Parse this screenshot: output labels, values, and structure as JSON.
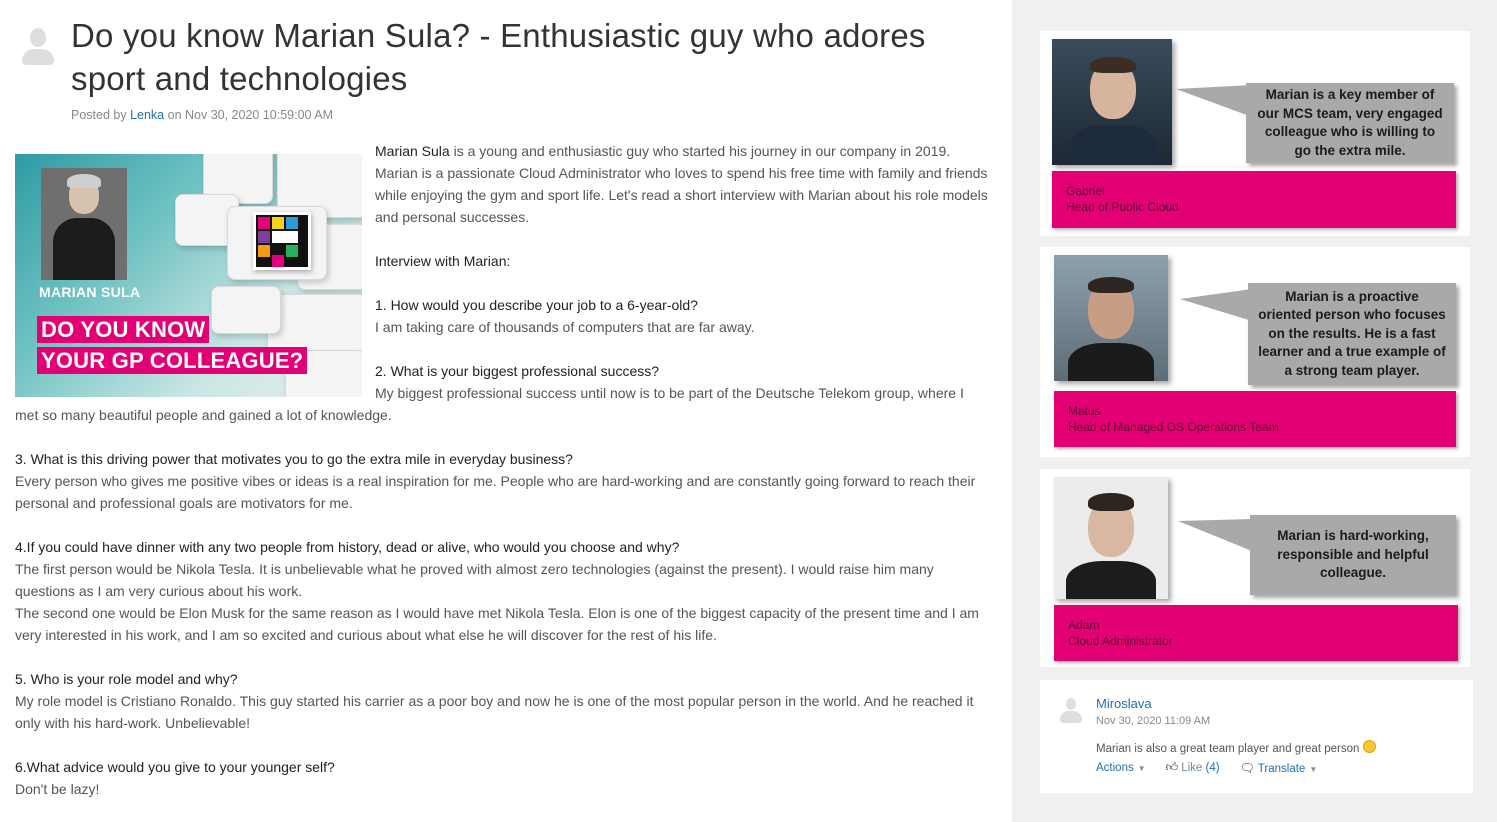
{
  "article": {
    "title": "Do you know Marian Sula? - Enthusiastic guy who adores sport and technologies",
    "meta": {
      "posted_by": "Posted by",
      "author": "Lenka",
      "on_date": "on Nov 30, 2020 10:59:00 AM"
    },
    "hero": {
      "name": "MARIAN SULA",
      "slogan_line1": "DO YOU KNOW",
      "slogan_line2": "YOUR GP COLLEAGUE?"
    },
    "intro": {
      "name": "Marian Sula",
      "rest": " is a young and enthusiastic guy who started his journey in our company in 2019. Marian is a passionate Cloud Administrator who loves to spend his free time with family and friends while enjoying the gym and sport life. Let's read a short interview with Marian about his role models and personal successes."
    },
    "interview_heading": "Interview with Marian:",
    "qa": [
      {
        "q": "1. How would you describe your job to a 6-year-old?",
        "a": [
          "I am taking care of thousands of computers that are far away."
        ]
      },
      {
        "q": "2. What is your biggest professional success?",
        "a": [
          "My biggest professional success until now is to be part of the Deutsche Telekom group, where I met so many beautiful people and gained a lot of knowledge."
        ]
      },
      {
        "q": "3. What is this driving power that motivates you to go the extra mile in everyday business?",
        "a": [
          "Every person who gives me positive vibes or ideas is a real inspiration for me.  People who are hard-working and are constantly going forward to reach their personal and professional goals are motivators for me."
        ]
      },
      {
        "q": "4.If you could have dinner with any two people from history, dead or alive, who would you choose and why?",
        "a": [
          "The first person would be Nikola Tesla. It is unbelievable what he proved with almost zero technologies (against the present). I would raise him many questions as I am very curious about his work.",
          "The second one would be Elon Musk for the same reason as I would have met Nikola Tesla. Elon is one of the biggest capacity of the present time and I am very interested in his work, and I am so excited and curious about what else he will discover for the rest of his life."
        ]
      },
      {
        "q": "5. Who is your role model and why?",
        "a": [
          "My role model is Cristiano Ronaldo. This guy started his carrier as a poor boy and now he is one of the most popular person in the world. And he reached it only with his hard-work. Unbelievable!"
        ]
      },
      {
        "q": "6.What advice would you give to your younger self?",
        "a": [
          "Don't be lazy!"
        ]
      }
    ]
  },
  "sidebar": {
    "testimonials": [
      {
        "quote": "Marian is a key member of our MCS team, very engaged colleague who is willing to go the extra mile.",
        "name": "Gabriel",
        "role": "Head of Public Cloud"
      },
      {
        "quote": "Marian is a proactive oriented person who focuses on the results. He is a fast learner and a true example of a strong team player.",
        "name": "Matus",
        "role": "Head of Managed OS Operations Team"
      },
      {
        "quote": "Marian is hard-working, responsible and helpful colleague.",
        "name": "Adam",
        "role": "Cloud Administrator"
      }
    ],
    "comment": {
      "author": "Miroslava",
      "date": "Nov 30, 2020 11:09 AM",
      "text": "Marian is also a great team player and great person",
      "actions_label": "Actions",
      "like_label": "Like",
      "like_count": "(4)",
      "translate_label": "Translate"
    }
  },
  "colors": {
    "magenta": "#e20074",
    "link": "#1f6fb2",
    "quote_box": "#a9a9a9",
    "sidebar_bg": "#f0f0f0"
  }
}
